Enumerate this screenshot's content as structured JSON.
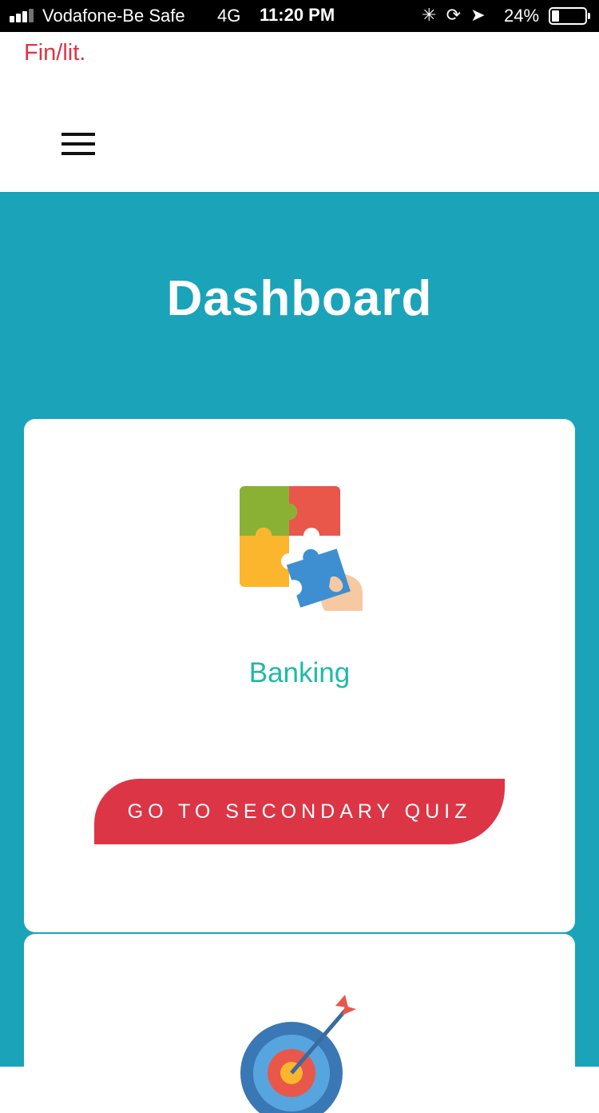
{
  "status_bar": {
    "carrier": "Vodafone-Be Safe",
    "network": "4G",
    "time": "11:20 PM",
    "battery": "24%"
  },
  "header": {
    "brand": "Fin/lit.",
    "menu_icon": "hamburger-menu-icon"
  },
  "main": {
    "title": "Dashboard",
    "cards": [
      {
        "icon": "puzzle-icon",
        "label": "Banking",
        "button_label": "GO TO SECONDARY QUIZ"
      },
      {
        "icon": "target-arrow-icon"
      }
    ]
  },
  "colors": {
    "brand": "#dc3545",
    "background_teal": "#1aa3b9",
    "label_teal": "#20b9a8",
    "button": "#dc3545"
  }
}
